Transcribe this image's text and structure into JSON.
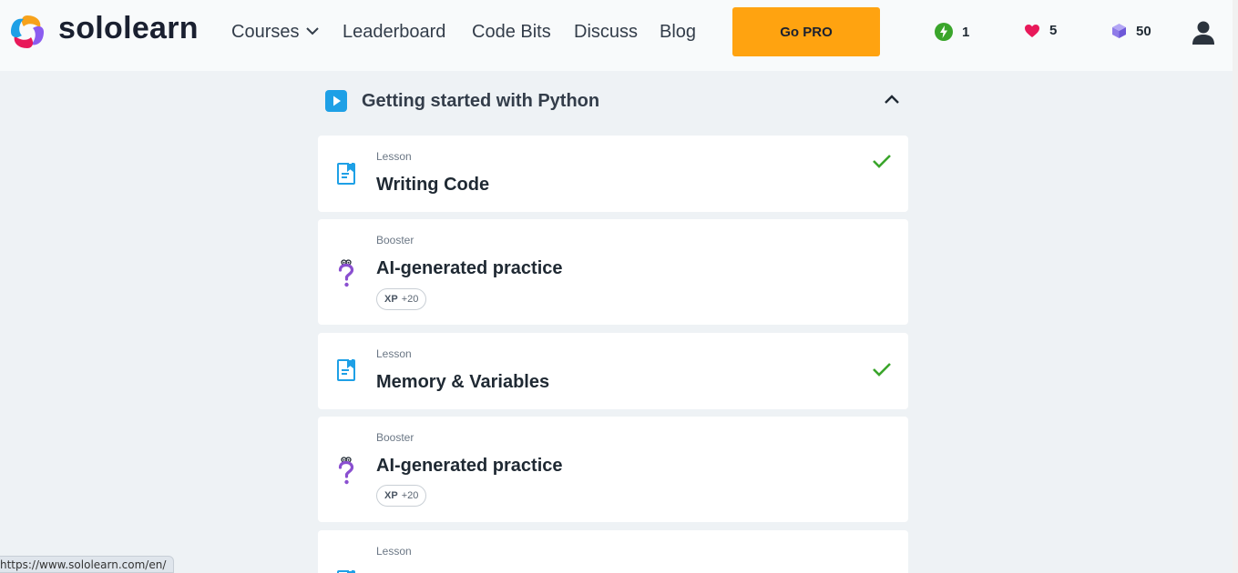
{
  "header": {
    "brand": "sololearn",
    "nav": {
      "courses": "Courses",
      "leaderboard": "Leaderboard",
      "code_bits": "Code Bits",
      "discuss": "Discuss",
      "blog": "Blog"
    },
    "gopro_label": "Go PRO",
    "stats": {
      "streak": "1",
      "hearts": "5",
      "gems": "50"
    }
  },
  "section": {
    "title": "Getting started with Python",
    "items": [
      {
        "kind": "Lesson",
        "title": "Writing Code",
        "completed": true,
        "icon": "lesson-doc-icon"
      },
      {
        "kind": "Booster",
        "title": "AI-generated practice",
        "xp_label": "XP",
        "xp_value": "+20",
        "icon": "question-mark-icon"
      },
      {
        "kind": "Lesson",
        "title": "Memory & Variables",
        "completed": true,
        "icon": "lesson-doc-icon"
      },
      {
        "kind": "Booster",
        "title": "AI-generated practice",
        "xp_label": "XP",
        "xp_value": "+20",
        "icon": "question-mark-icon"
      },
      {
        "kind": "Lesson",
        "icon": "lesson-doc-icon"
      }
    ]
  },
  "status_url": "https://www.sololearn.com/en/",
  "colors": {
    "accent_orange": "#ffa310",
    "lesson_blue": "#1ea0e6",
    "booster_purple": "#8a4fd0",
    "check_green": "#3aa52b",
    "heart_red": "#e8195a",
    "gem_purple": "#8f7be8"
  }
}
